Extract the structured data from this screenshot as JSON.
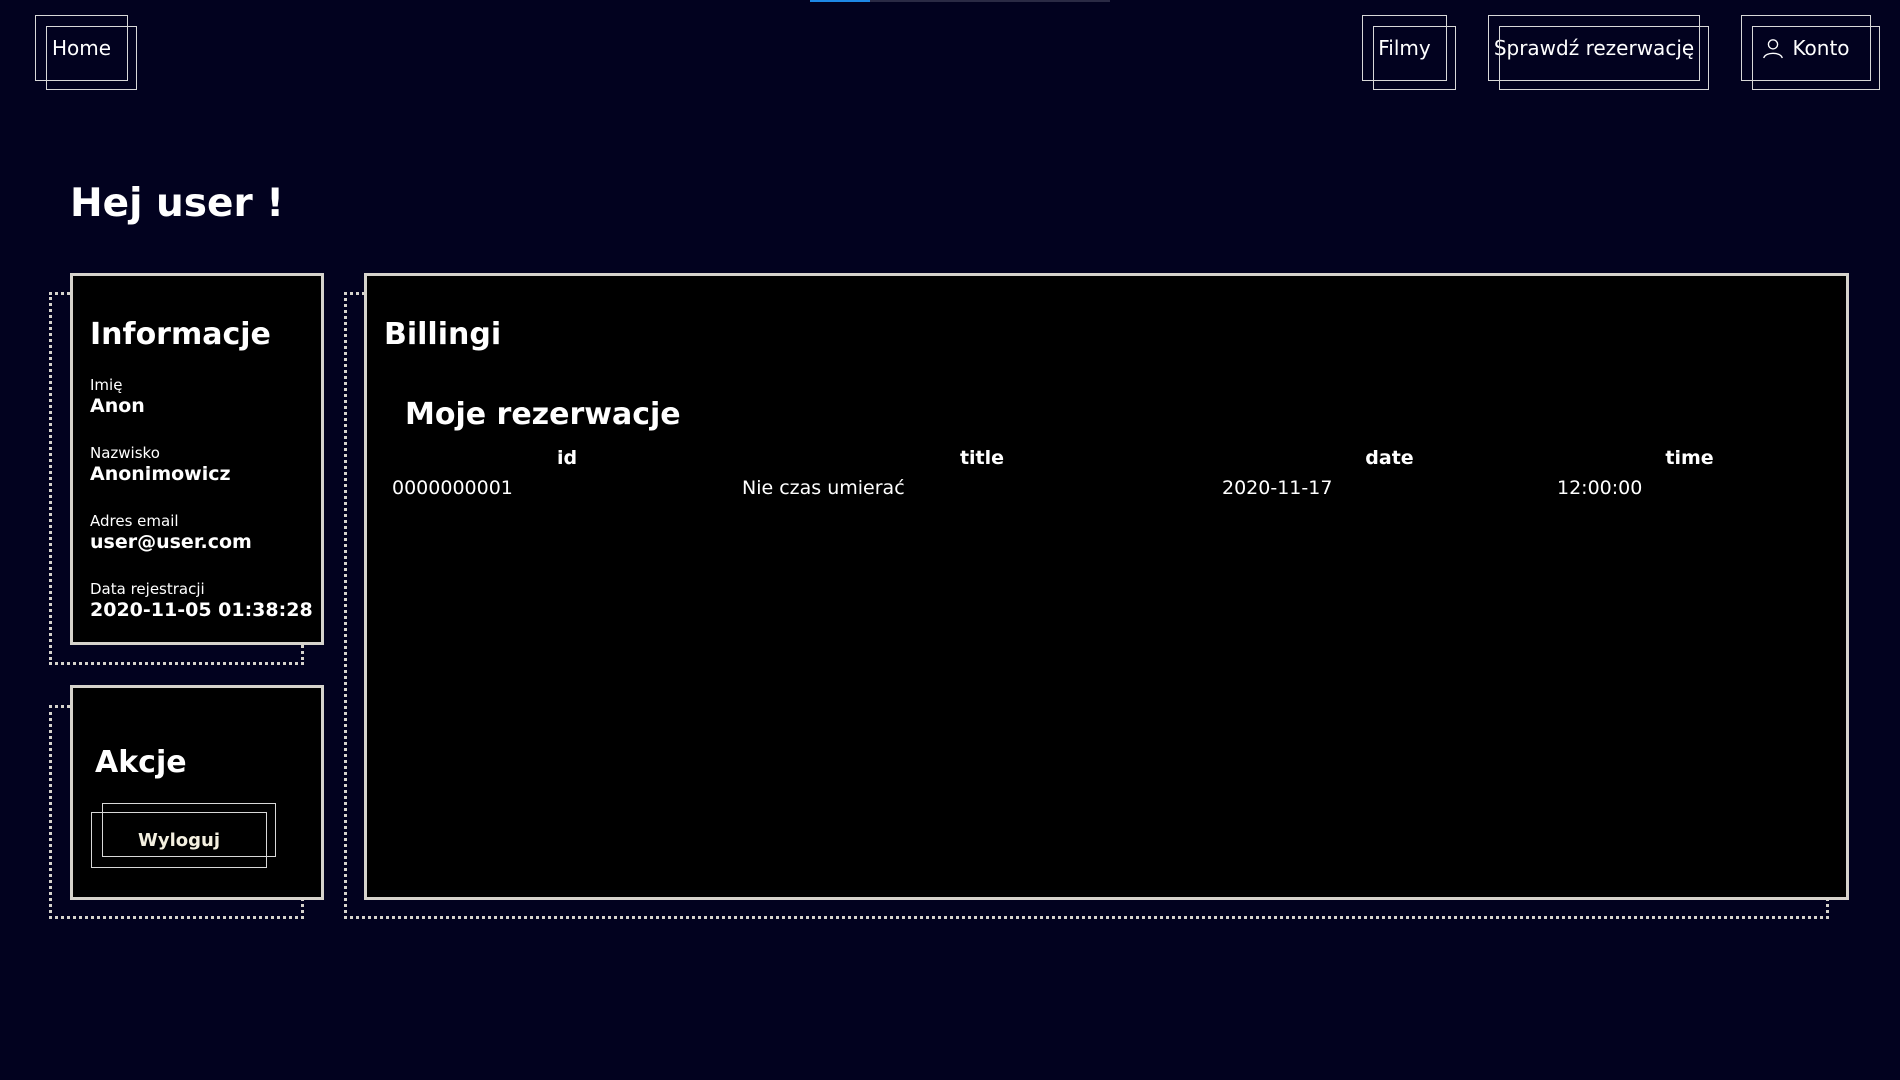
{
  "nav": {
    "home": "Home",
    "filmy": "Filmy",
    "sprawdz": "Sprawdź rezerwację",
    "konto": "Konto"
  },
  "loading_progress": 0.2,
  "greeting": "Hej user !",
  "info": {
    "title": "Informacje",
    "fields": [
      {
        "label": "Imię",
        "value": "Anon"
      },
      {
        "label": "Nazwisko",
        "value": "Anonimowicz"
      },
      {
        "label": "Adres email",
        "value": "user@user.com"
      },
      {
        "label": "Data rejestracji",
        "value": "2020-11-05 01:38:28"
      }
    ]
  },
  "actions": {
    "title": "Akcje",
    "logout": "Wyloguj"
  },
  "billing": {
    "title": "Billingi",
    "reservations_title": "Moje rezerwacje",
    "columns": [
      "id",
      "title",
      "date",
      "time"
    ],
    "rows": [
      [
        "0000000001",
        "Nie czas umierać",
        "2020-11-17",
        "12:00:00"
      ]
    ]
  },
  "colors": {
    "background": "#02021f",
    "card_background": "#000000",
    "border": "#d6d3cc",
    "loading_accent": "#1e88e5"
  },
  "icons": {
    "account": "user-icon"
  }
}
